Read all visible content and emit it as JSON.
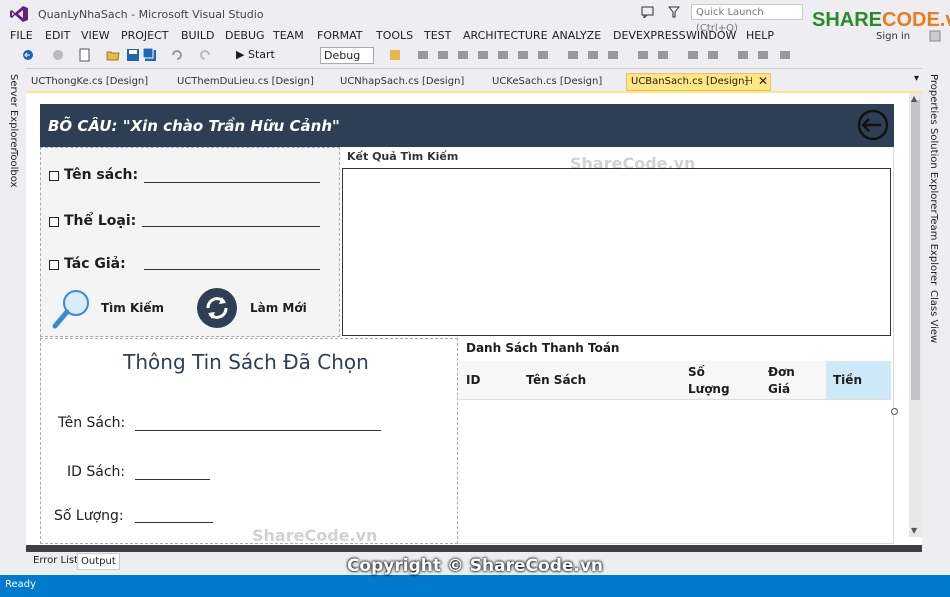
{
  "window": {
    "title": "QuanLyNhaSach - Microsoft Visual Studio",
    "quick_launch_placeholder": "Quick Launch (Ctrl+Q)",
    "brand_part1": "SHARE",
    "brand_part2": "CODE.vn",
    "sign_in": "Sign in"
  },
  "menu": [
    "FILE",
    "EDIT",
    "VIEW",
    "PROJECT",
    "BUILD",
    "DEBUG",
    "TEAM",
    "FORMAT",
    "TOOLS",
    "TEST",
    "ARCHITECTURE",
    "ANALYZE",
    "DEVEXPRESS",
    "WINDOW",
    "HELP"
  ],
  "toolbar": {
    "start_label": "▶ Start",
    "configuration": "Debug"
  },
  "side_left": [
    "Server Explorer",
    "Toolbox"
  ],
  "side_right": [
    "Properties",
    "Solution Explorer",
    "Team Explorer",
    "Class View"
  ],
  "tabs": [
    {
      "label": "UCThongKe.cs [Design]"
    },
    {
      "label": "UCThemDuLieu.cs [Design]"
    },
    {
      "label": "UCNhapSach.cs [Design]"
    },
    {
      "label": "UCKeSach.cs [Design]"
    },
    {
      "label": "UCBanSach.cs [Design]",
      "active": true
    }
  ],
  "form": {
    "header": "BÕ CÂU: \"Xin chào Trần Hữu Cảnh\"",
    "search": {
      "ten_sach": "Tên sách:",
      "the_loai": "Thể Loại:",
      "tac_gia": "Tác Giả:",
      "search_btn": "Tìm Kiếm",
      "refresh_btn": "Làm Mới"
    },
    "results_label": "Kết Quả Tìm Kiếm",
    "info": {
      "title": "Thông Tin Sách Đã Chọn",
      "ten_sach": "Tên Sách:",
      "id_sach": "ID Sách:",
      "so_luong": "Số Lượng:"
    },
    "payment": {
      "label": "Danh Sách Thanh Toán",
      "columns": [
        "ID",
        "Tên Sách",
        "Số Lượng",
        "Đơn Giá",
        "Tiền"
      ]
    }
  },
  "watermarks": [
    "ShareCode.vn",
    "ShareCode.vn"
  ],
  "output_tabs": [
    "Error List",
    "Output"
  ],
  "status": "Ready",
  "copyright": "Copyright © ShareCode.vn"
}
